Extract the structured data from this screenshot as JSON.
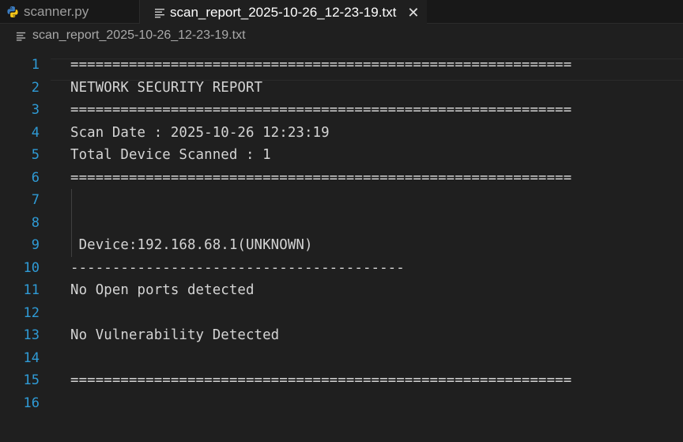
{
  "tabs": [
    {
      "label": "scanner.py",
      "icon": "python-icon",
      "active": false
    },
    {
      "label": "scan_report_2025-10-26_12-23-19.txt",
      "icon": "text-file-icon",
      "active": true,
      "close": "✕"
    }
  ],
  "breadcrumb": {
    "file": "scan_report_2025-10-26_12-23-19.txt",
    "icon": "text-file-icon"
  },
  "lines": [
    {
      "n": "1",
      "text": "============================================================"
    },
    {
      "n": "2",
      "text": "NETWORK SECURITY REPORT"
    },
    {
      "n": "3",
      "text": "============================================================"
    },
    {
      "n": "4",
      "text": "Scan Date : 2025-10-26 12:23:19"
    },
    {
      "n": "5",
      "text": "Total Device Scanned : 1"
    },
    {
      "n": "6",
      "text": "============================================================"
    },
    {
      "n": "7",
      "text": ""
    },
    {
      "n": "8",
      "text": ""
    },
    {
      "n": "9",
      "text": " Device:192.168.68.1(UNKNOWN)"
    },
    {
      "n": "10",
      "text": "----------------------------------------"
    },
    {
      "n": "11",
      "text": "No Open ports detected"
    },
    {
      "n": "12",
      "text": ""
    },
    {
      "n": "13",
      "text": "No Vulnerability Detected"
    },
    {
      "n": "14",
      "text": ""
    },
    {
      "n": "15",
      "text": "============================================================"
    },
    {
      "n": "16",
      "text": ""
    }
  ],
  "colors": {
    "line_number": "#2f9bd6",
    "text": "#d4d4d4",
    "background": "#1f1f1f"
  }
}
